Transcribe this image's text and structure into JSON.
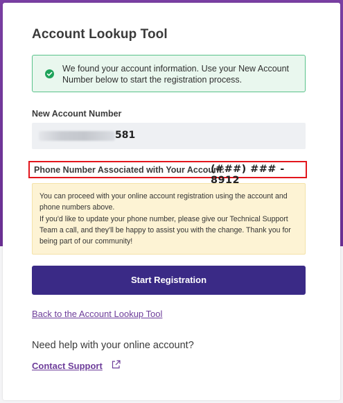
{
  "page": {
    "title": "Account Lookup Tool"
  },
  "success_alert": {
    "icon": "check-circle-icon",
    "message": "We found your account information. Use your New Account Number below to start the registration process."
  },
  "account": {
    "label": "New Account Number",
    "value_suffix": "581"
  },
  "phone": {
    "label": "Phone Number Associated with Your Account:",
    "value": "(###) ### - 8912"
  },
  "notice": {
    "paragraph1": "You can proceed with your online account registration using the account and phone numbers above.",
    "paragraph2": "If you'd like to update your phone number, please give our Technical Support Team a call, and they'll be happy to assist you with the change. Thank you for being part of our community!"
  },
  "actions": {
    "start_registration": "Start Registration",
    "back_link": "Back to the Account Lookup Tool"
  },
  "help": {
    "text": "Need help with your online account?",
    "contact_link": "Contact Support",
    "contact_icon": "external-link-icon"
  },
  "colors": {
    "brand_purple": "#6a2f93",
    "button": "#3a2a86",
    "link": "#6d3d9a",
    "success_border": "#58c28a",
    "highlight_border": "#e2151c"
  }
}
